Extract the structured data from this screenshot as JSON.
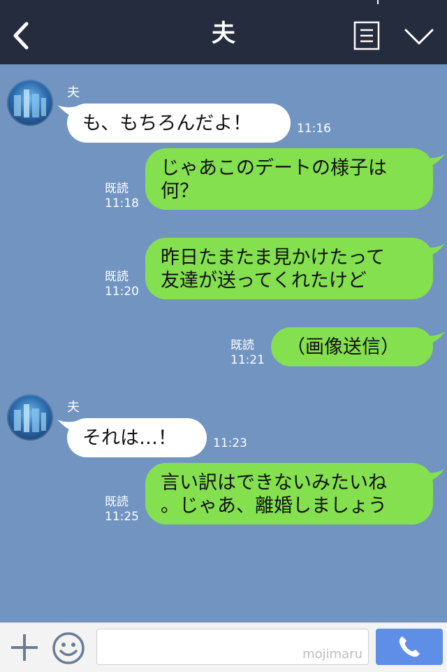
{
  "header": {
    "title": "夫"
  },
  "messages": [
    {
      "side": "in",
      "sender": "夫",
      "text": "も、もちろんだよ！",
      "time": "11:16"
    },
    {
      "side": "out",
      "lines": [
        "じゃあこのデートの様子は",
        "何？"
      ],
      "read": "既読",
      "time": "11:18"
    },
    {
      "side": "out",
      "lines": [
        "昨日たまたま見かけたって",
        "友達が送ってくれたけど"
      ],
      "read": "既読",
      "time": "11:20"
    },
    {
      "side": "out",
      "lines": [
        "（画像送信）"
      ],
      "read": "既読",
      "time": "11:21"
    },
    {
      "side": "in",
      "sender": "夫",
      "text": "それは…！",
      "time": "11:23"
    },
    {
      "side": "out",
      "lines": [
        "言い訳はできないみたいね",
        "。じゃあ、離婚しましょう"
      ],
      "read": "既読",
      "time": "11:25"
    }
  ],
  "input": {
    "watermark": "mojimaru"
  },
  "colors": {
    "header": "#252c3d",
    "chat_bg": "#7194c1",
    "out_bubble": "#84e04f",
    "in_bubble": "#ffffff",
    "call_button": "#5f8ee6"
  },
  "icons": [
    "back-icon",
    "menu-icon",
    "chevron-down-icon",
    "plus-icon",
    "smile-icon",
    "phone-icon"
  ]
}
